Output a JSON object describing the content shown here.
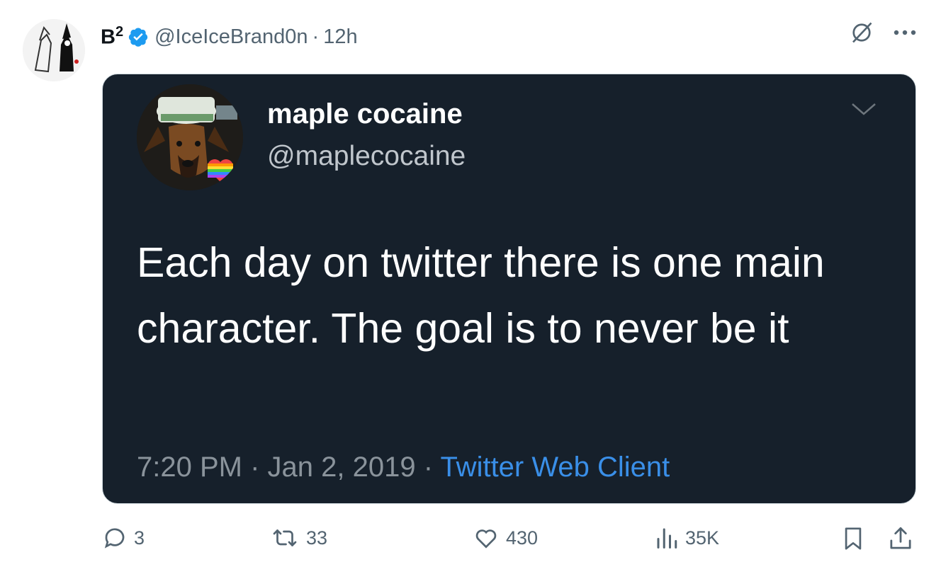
{
  "author": {
    "display_name": "B",
    "superscript": "2",
    "handle": "@IceIceBrand0n",
    "separator": "·",
    "time": "12h"
  },
  "quoted": {
    "display_name": "maple cocaine",
    "handle": "@maplecocaine",
    "text": "Each day on twitter there is one main character. The goal is to never be it",
    "time": "7:20 PM",
    "date": "Jan 2, 2019",
    "client": "Twitter Web Client",
    "sep": "·"
  },
  "actions": {
    "replies": "3",
    "reposts": "33",
    "likes": "430",
    "views": "35K"
  },
  "colors": {
    "card_bg": "#16202b",
    "verified": "#1d9bf0",
    "link": "#3a8fe8",
    "muted": "#536471"
  },
  "icons": [
    "grok-icon",
    "more-icon",
    "chevron-down-icon",
    "reply-icon",
    "repost-icon",
    "like-icon",
    "views-icon",
    "bookmark-icon",
    "share-icon",
    "verified-badge-icon"
  ]
}
